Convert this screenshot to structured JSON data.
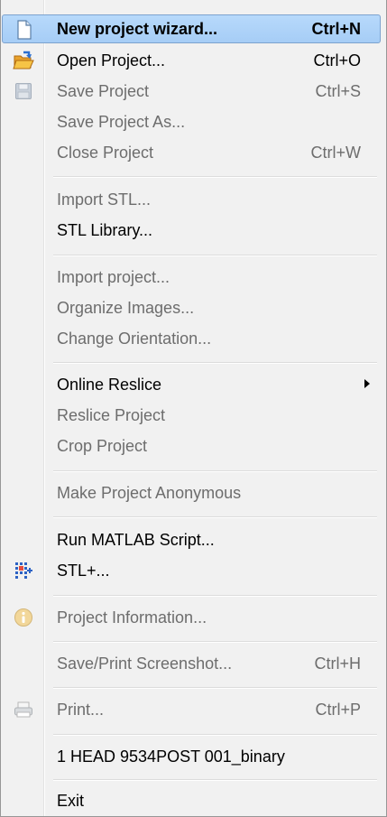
{
  "menu": {
    "items": [
      {
        "id": "new",
        "label": "New project wizard...",
        "shortcut": "Ctrl+N",
        "icon": "new-document-icon",
        "enabled": true,
        "highlighted": true
      },
      {
        "id": "open",
        "label": "Open Project...",
        "shortcut": "Ctrl+O",
        "icon": "open-folder-icon",
        "enabled": true
      },
      {
        "id": "save",
        "label": "Save Project",
        "shortcut": "Ctrl+S",
        "icon": "floppy-disk-icon",
        "enabled": false
      },
      {
        "id": "save-as",
        "label": "Save Project As...",
        "shortcut": "",
        "enabled": false
      },
      {
        "id": "close",
        "label": "Close Project",
        "shortcut": "Ctrl+W",
        "enabled": false
      },
      {
        "id": "import-stl",
        "label": "Import STL...",
        "enabled": false
      },
      {
        "id": "stl-library",
        "label": "STL Library...",
        "enabled": true
      },
      {
        "id": "import-project",
        "label": "Import project...",
        "enabled": false
      },
      {
        "id": "organize-images",
        "label": "Organize Images...",
        "enabled": false
      },
      {
        "id": "change-orientation",
        "label": "Change Orientation...",
        "enabled": false
      },
      {
        "id": "online-reslice",
        "label": "Online Reslice",
        "enabled": true,
        "submenu": true
      },
      {
        "id": "reslice-project",
        "label": "Reslice Project",
        "enabled": false
      },
      {
        "id": "crop-project",
        "label": "Crop Project",
        "enabled": false
      },
      {
        "id": "make-anonymous",
        "label": "Make Project Anonymous",
        "enabled": false
      },
      {
        "id": "run-matlab",
        "label": "Run MATLAB Script...",
        "enabled": true
      },
      {
        "id": "stl-plus",
        "label": "STL+...",
        "icon": "stl-plus-grid-icon",
        "enabled": true
      },
      {
        "id": "project-info",
        "label": "Project Information...",
        "icon": "info-icon",
        "enabled": false
      },
      {
        "id": "screenshot",
        "label": "Save/Print Screenshot...",
        "shortcut": "Ctrl+H",
        "enabled": false
      },
      {
        "id": "print",
        "label": "Print...",
        "shortcut": "Ctrl+P",
        "icon": "printer-icon",
        "enabled": false
      },
      {
        "id": "recent-1",
        "label": "1 HEAD 9534POST 001_binary",
        "enabled": true
      },
      {
        "id": "exit",
        "label": "Exit",
        "enabled": true
      }
    ],
    "colors": {
      "highlight": "#b7d9fb",
      "highlight_border": "#7da2ce",
      "disabled_text": "#6d6d6d",
      "background": "#f1f1f1"
    }
  }
}
